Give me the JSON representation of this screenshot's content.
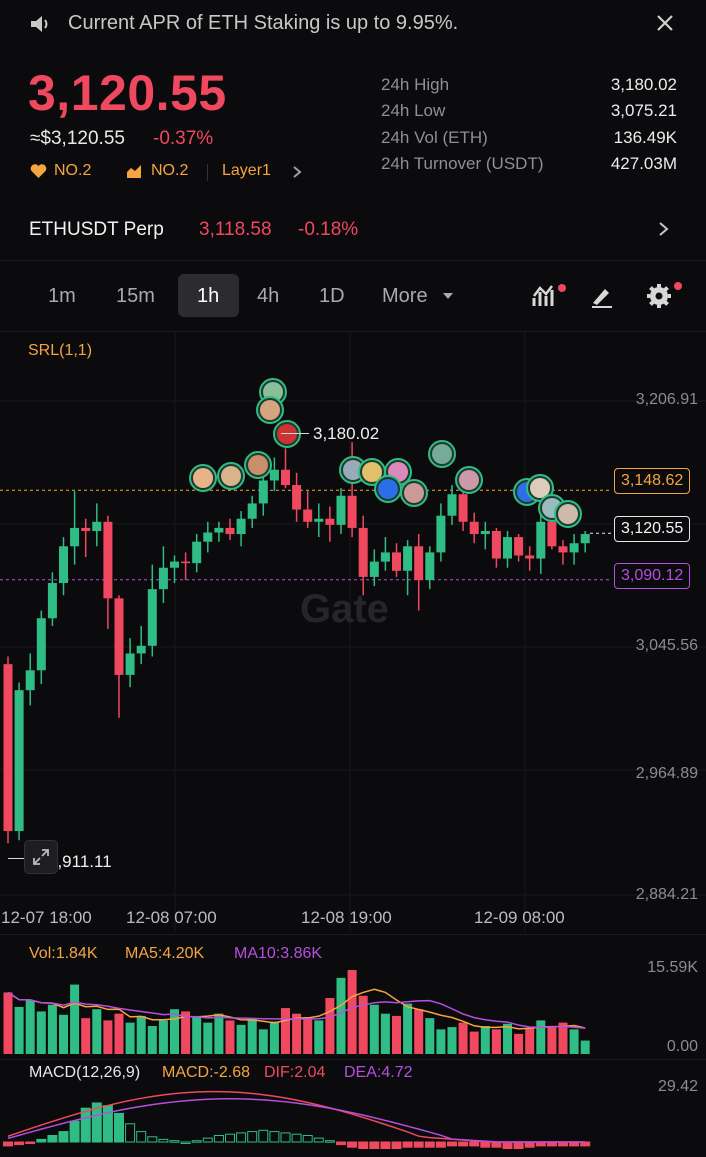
{
  "banner": {
    "icon": "speaker-icon",
    "text": "Current APR of ETH Staking is up to 9.95%.",
    "close_icon": "close-icon"
  },
  "header": {
    "price": "3,120.55",
    "usd_price": "≈$3,120.55",
    "change": "-0.37%",
    "tags": [
      {
        "icon": "heart-icon",
        "label": "NO.2"
      },
      {
        "icon": "rising-chart-icon",
        "label": "NO.2"
      },
      {
        "label": "Layer1"
      }
    ]
  },
  "stats": [
    {
      "label": "24h High",
      "value": "3,180.02"
    },
    {
      "label": "24h Low",
      "value": "3,075.21"
    },
    {
      "label": "24h Vol (ETH)",
      "value": "136.49K"
    },
    {
      "label": "24h Turnover (USDT)",
      "value": "427.03M"
    }
  ],
  "perp": {
    "name": "ETHUSDT Perp",
    "price": "3,118.58",
    "change": "-0.18%"
  },
  "intervals": [
    "1m",
    "15m",
    "1h",
    "4h",
    "1D",
    "More"
  ],
  "active_interval": "1h",
  "colors": {
    "up": "#2fbd85",
    "down": "#f0485f",
    "accent": "#f5a442",
    "purple": "#b64ee0",
    "bg": "#0b0b0d"
  },
  "chart": {
    "indicator": "SRL(1,1)",
    "watermark": "Gate",
    "axis": [
      "3,206.91",
      "3,045.56",
      "2,964.89",
      "2,884.21"
    ],
    "high_marker": "3,180.02",
    "low_marker": "2,911.11",
    "lines": {
      "orange": "3,148.62",
      "current": "3,120.55",
      "purple": "3,090.12"
    },
    "time_labels": [
      "12-07 18:00",
      "12-08 07:00",
      "12-08 19:00",
      "12-09 08:00"
    ]
  },
  "volume": {
    "vol": "Vol:1.84K",
    "ma5": "MA5:4.20K",
    "ma10": "MA10:3.86K",
    "max": "15.59K",
    "min": "0.00"
  },
  "macd": {
    "label": "MACD(12,26,9)",
    "macd": "MACD:-2.68",
    "dif": "DIF:2.04",
    "dea": "DEA:4.72",
    "max": "29.42"
  },
  "chart_data": {
    "type": "candlestick",
    "y_axis_ticks": [
      3206.91,
      3045.56,
      2964.89,
      2884.21
    ],
    "candles_ohlc": [
      [
        3035,
        3040,
        2918,
        2926
      ],
      [
        2926,
        3023,
        2920,
        3018
      ],
      [
        3018,
        3042,
        3008,
        3031
      ],
      [
        3031,
        3070,
        3022,
        3065
      ],
      [
        3065,
        3095,
        3060,
        3088
      ],
      [
        3088,
        3118,
        3080,
        3112
      ],
      [
        3112,
        3148,
        3100,
        3124
      ],
      [
        3124,
        3130,
        3105,
        3122
      ],
      [
        3122,
        3140,
        3112,
        3128
      ],
      [
        3128,
        3132,
        3058,
        3078
      ],
      [
        3078,
        3080,
        3000,
        3028
      ],
      [
        3028,
        3052,
        3020,
        3042
      ],
      [
        3042,
        3060,
        3035,
        3047
      ],
      [
        3047,
        3100,
        3040,
        3084
      ],
      [
        3084,
        3112,
        3075,
        3098
      ],
      [
        3098,
        3106,
        3088,
        3102
      ],
      [
        3102,
        3108,
        3090,
        3101
      ],
      [
        3101,
        3120,
        3095,
        3115
      ],
      [
        3115,
        3128,
        3108,
        3121
      ],
      [
        3121,
        3128,
        3115,
        3124
      ],
      [
        3124,
        3130,
        3116,
        3120
      ],
      [
        3120,
        3135,
        3112,
        3130
      ],
      [
        3130,
        3145,
        3124,
        3140
      ],
      [
        3140,
        3160,
        3132,
        3155
      ],
      [
        3155,
        3170,
        3148,
        3162
      ],
      [
        3162,
        3176,
        3150,
        3152
      ],
      [
        3152,
        3160,
        3128,
        3136
      ],
      [
        3136,
        3148,
        3124,
        3128
      ],
      [
        3128,
        3140,
        3118,
        3130
      ],
      [
        3130,
        3138,
        3115,
        3126
      ],
      [
        3126,
        3150,
        3120,
        3145
      ],
      [
        3145,
        3180,
        3118,
        3124
      ],
      [
        3124,
        3132,
        3080,
        3092
      ],
      [
        3092,
        3110,
        3086,
        3102
      ],
      [
        3102,
        3118,
        3096,
        3108
      ],
      [
        3108,
        3114,
        3092,
        3096
      ],
      [
        3096,
        3116,
        3080,
        3112
      ],
      [
        3112,
        3120,
        3070,
        3090
      ],
      [
        3090,
        3112,
        3084,
        3108
      ],
      [
        3108,
        3140,
        3102,
        3132
      ],
      [
        3132,
        3152,
        3126,
        3146
      ],
      [
        3146,
        3150,
        3122,
        3128
      ],
      [
        3128,
        3134,
        3114,
        3120
      ],
      [
        3120,
        3128,
        3110,
        3122
      ],
      [
        3122,
        3124,
        3098,
        3104
      ],
      [
        3104,
        3122,
        3098,
        3118
      ],
      [
        3118,
        3120,
        3102,
        3106
      ],
      [
        3106,
        3112,
        3096,
        3104
      ],
      [
        3104,
        3136,
        3094,
        3128
      ],
      [
        3128,
        3140,
        3110,
        3112
      ],
      [
        3112,
        3116,
        3100,
        3108
      ],
      [
        3108,
        3120,
        3100,
        3114
      ],
      [
        3114,
        3122,
        3108,
        3120
      ]
    ]
  }
}
